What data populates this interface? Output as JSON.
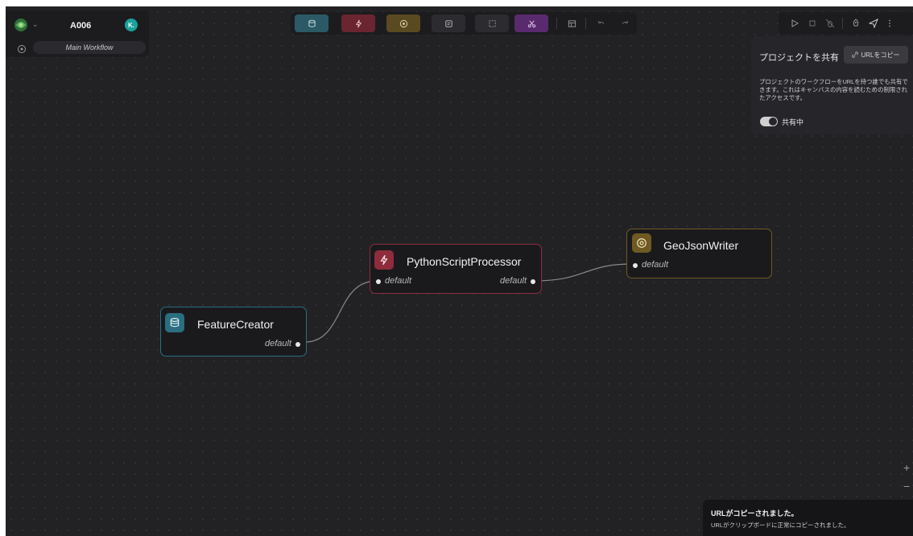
{
  "project": {
    "name": "A006",
    "avatar_initial": "K.",
    "workflow_name": "Main Workflow"
  },
  "toolbar": {
    "buttons": [
      {
        "name": "reader-tool-button",
        "icon": "database-icon",
        "color": "#2b5a66"
      },
      {
        "name": "transformer-tool-button",
        "icon": "lightning-icon",
        "color": "#6b2530"
      },
      {
        "name": "writer-tool-button",
        "icon": "disc-icon",
        "color": "#5a4a22"
      },
      {
        "name": "note-tool-button",
        "icon": "note-icon",
        "color": "#2c2c30"
      },
      {
        "name": "batch-tool-button",
        "icon": "dashed-square-icon",
        "color": "#2c2c30"
      },
      {
        "name": "subworkflow-tool-button",
        "icon": "scissors-icon",
        "color": "#5a2a6e"
      }
    ]
  },
  "share": {
    "title": "プロジェクトを共有",
    "copy_label": "URLをコピー",
    "description": "プロジェクトのワークフローをURLを持つ誰でも共有できます。これはキャンバスの内容を読むための制限されたアクセスです。",
    "toggle_label": "共有中",
    "toggle_on": true
  },
  "nodes": {
    "feature_creator": {
      "title": "FeatureCreator",
      "output_port": "default",
      "accent": "#2a6e80"
    },
    "python_processor": {
      "title": "PythonScriptProcessor",
      "input_port": "default",
      "output_port": "default",
      "accent": "#8e2c3c"
    },
    "geojson_writer": {
      "title": "GeoJsonWriter",
      "input_port": "default",
      "accent": "#6e5a22"
    }
  },
  "zoom": {
    "in": "+",
    "out": "−"
  },
  "toast": {
    "title": "URLがコピーされました。",
    "message": "URLがクリップボードに正常にコピーされました。"
  }
}
